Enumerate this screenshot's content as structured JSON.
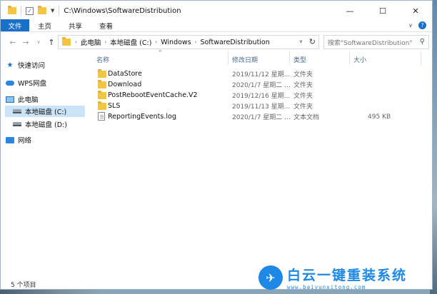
{
  "window": {
    "title": "C:\\Windows\\SoftwareDistribution",
    "controls": {
      "minimize": "—",
      "maximize": "☐",
      "close": "✕"
    }
  },
  "ribbon": {
    "tabs": [
      "文件",
      "主页",
      "共享",
      "查看"
    ]
  },
  "address": {
    "crumbs": [
      "此电脑",
      "本地磁盘 (C:)",
      "Windows",
      "SoftwareDistribution"
    ]
  },
  "search": {
    "placeholder": "搜索\"SoftwareDistribution\""
  },
  "sidebar": {
    "items": [
      {
        "label": "快速访问",
        "icon": "star-icon"
      },
      {
        "label": "WPS网盘",
        "icon": "cloud-icon"
      },
      {
        "label": "此电脑",
        "icon": "pc-icon"
      },
      {
        "label": "本地磁盘 (C:)",
        "icon": "drive-icon",
        "selected": true
      },
      {
        "label": "本地磁盘 (D:)",
        "icon": "drive-icon"
      },
      {
        "label": "网络",
        "icon": "network-icon"
      }
    ]
  },
  "columns": {
    "name": "名称",
    "date": "修改日期",
    "type": "类型",
    "size": "大小"
  },
  "files": [
    {
      "name": "DataStore",
      "date": "2019/11/12 星期...",
      "type": "文件夹",
      "size": "",
      "kind": "folder"
    },
    {
      "name": "Download",
      "date": "2020/1/7 星期二 ...",
      "type": "文件夹",
      "size": "",
      "kind": "folder"
    },
    {
      "name": "PostRebootEventCache.V2",
      "date": "2019/12/16 星期...",
      "type": "文件夹",
      "size": "",
      "kind": "folder"
    },
    {
      "name": "SLS",
      "date": "2019/11/13 星期...",
      "type": "文件夹",
      "size": "",
      "kind": "folder"
    },
    {
      "name": "ReportingEvents.log",
      "date": "2020/1/7 星期二 ...",
      "type": "文本文档",
      "size": "495 KB",
      "kind": "file"
    }
  ],
  "status": {
    "count": "5 个项目"
  },
  "watermark": {
    "title": "白云一键重装系统",
    "url": "www.baiyunxitong.com"
  },
  "colors": {
    "accent": "#1a6fc9",
    "selection": "#cce4f7",
    "folder": "#f4c542"
  }
}
